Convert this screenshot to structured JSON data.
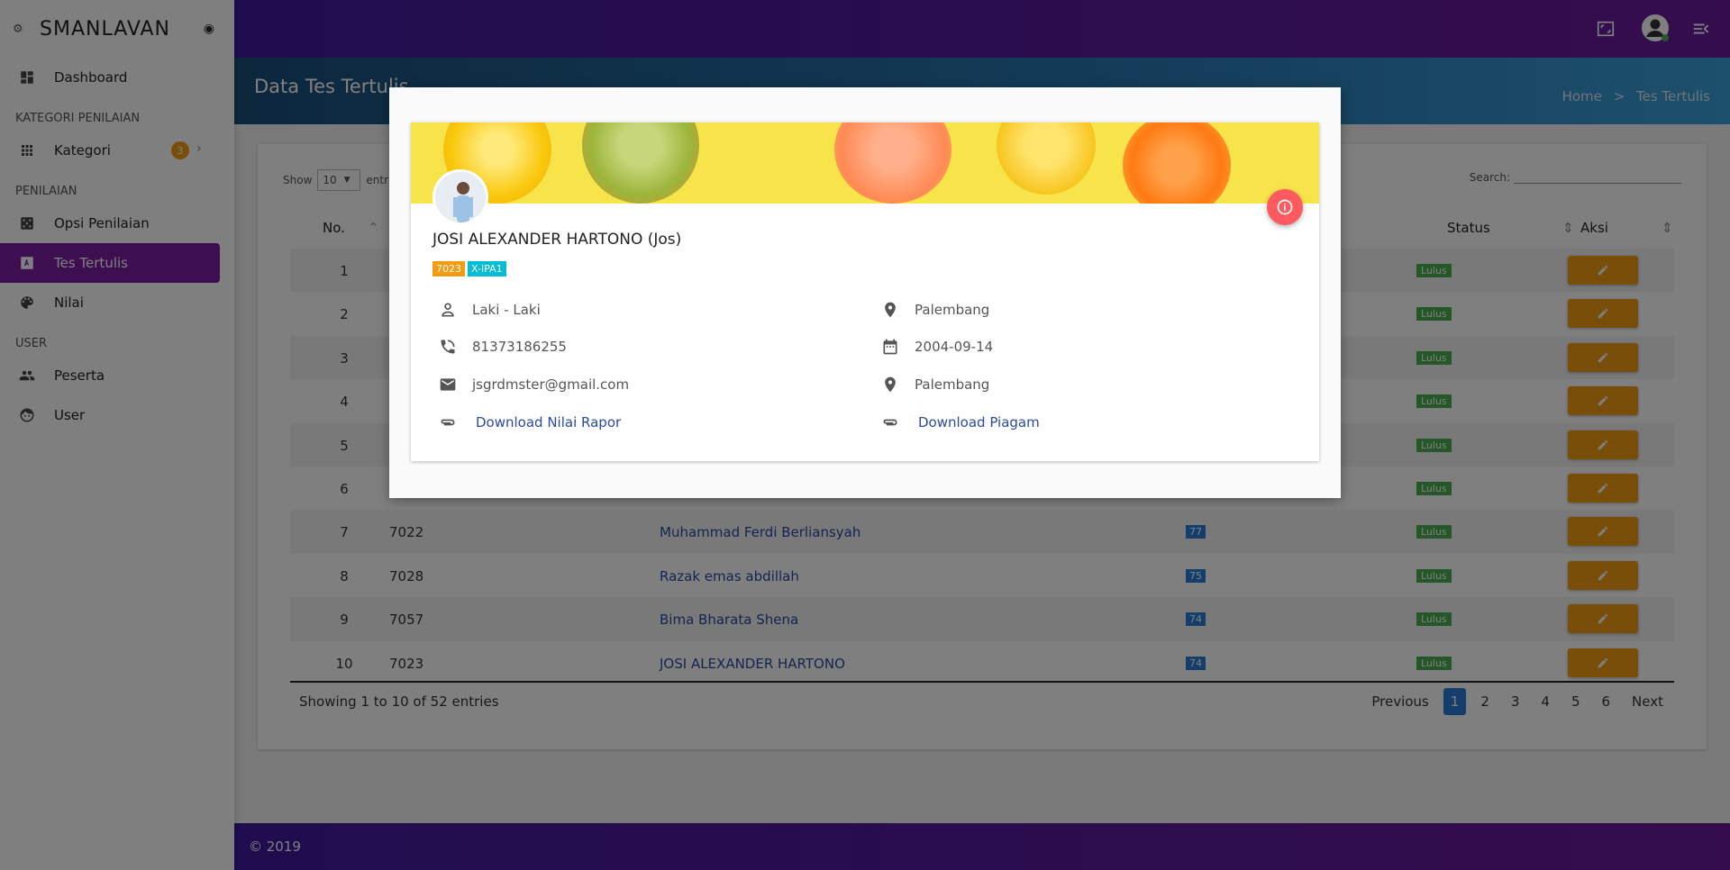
{
  "app": {
    "brand": "SMANLAVAN",
    "page_title": "Data Tes Tertulis",
    "breadcrumb": [
      "Home",
      ">",
      "Tes Tertulis"
    ],
    "footer": "© 2019"
  },
  "sidebar": {
    "items": [
      {
        "section": "",
        "label": "Dashboard",
        "icon": "dashboard-icon"
      },
      {
        "section": "KATEGORI PENILAIAN",
        "label": "Kategori",
        "icon": "grid-icon",
        "badge": "3"
      },
      {
        "section": "PENILAIAN",
        "label": "Opsi Penilaian",
        "icon": "dice-icon"
      },
      {
        "section": "",
        "label": "Tes Tertulis",
        "icon": "text-box-icon",
        "active": true
      },
      {
        "section": "",
        "label": "Nilai",
        "icon": "palette-icon"
      },
      {
        "section": "USER",
        "label": "Peserta",
        "icon": "group-icon"
      },
      {
        "section": "",
        "label": "User",
        "icon": "face-icon"
      }
    ],
    "sections": {
      "kategori": "KATEGORI PENILAIAN",
      "penilaian": "PENILAIAN",
      "user": "USER"
    }
  },
  "table": {
    "show_label": "Show",
    "entries_value": "10",
    "entries_label": "entries",
    "search_label": "Search:",
    "headers": {
      "no": "No.",
      "status": "Status",
      "aksi": "Aksi"
    },
    "rows": [
      {
        "no": "1",
        "id": "",
        "name": "",
        "score": "",
        "status": "Lulus"
      },
      {
        "no": "2",
        "id": "",
        "name": "",
        "score": "",
        "status": "Lulus"
      },
      {
        "no": "3",
        "id": "",
        "name": "",
        "score": "",
        "status": "Lulus"
      },
      {
        "no": "4",
        "id": "",
        "name": "",
        "score": "",
        "status": "Lulus"
      },
      {
        "no": "5",
        "id": "",
        "name": "",
        "score": "",
        "status": "Lulus"
      },
      {
        "no": "6",
        "id": "",
        "name": "",
        "score": "",
        "status": "Lulus"
      },
      {
        "no": "7",
        "id": "7022",
        "name": "Muhammad Ferdi Berliansyah",
        "score": "77",
        "status": "Lulus"
      },
      {
        "no": "8",
        "id": "7028",
        "name": "Razak emas abdillah",
        "score": "75",
        "status": "Lulus"
      },
      {
        "no": "9",
        "id": "7057",
        "name": "Bima Bharata Shena",
        "score": "74",
        "status": "Lulus"
      },
      {
        "no": "10",
        "id": "7023",
        "name": "JOSI ALEXANDER HARTONO",
        "score": "74",
        "status": "Lulus"
      }
    ],
    "info": "Showing 1 to 10 of 52 entries",
    "pager": {
      "previous": "Previous",
      "pages": [
        "1",
        "2",
        "3",
        "4",
        "5",
        "6"
      ],
      "next": "Next",
      "current": "1"
    }
  },
  "modal": {
    "name": "JOSI ALEXANDER HARTONO (Jos)",
    "tags": [
      "7023",
      "X-IPA1"
    ],
    "gender": "Laki - Laki",
    "birthplace": "Palembang",
    "phone": "81373186255",
    "birthdate": "2004-09-14",
    "email": "jsgrdmster@gmail.com",
    "address": "Palembang",
    "download_rapor": "Download Nilai Rapor",
    "download_piagam": "Download Piagam"
  },
  "colors": {
    "accent": "#7b1fa2",
    "badge": "#f39c12",
    "info_btn": "#ff5a5f",
    "tag2": "#00bcd4"
  }
}
